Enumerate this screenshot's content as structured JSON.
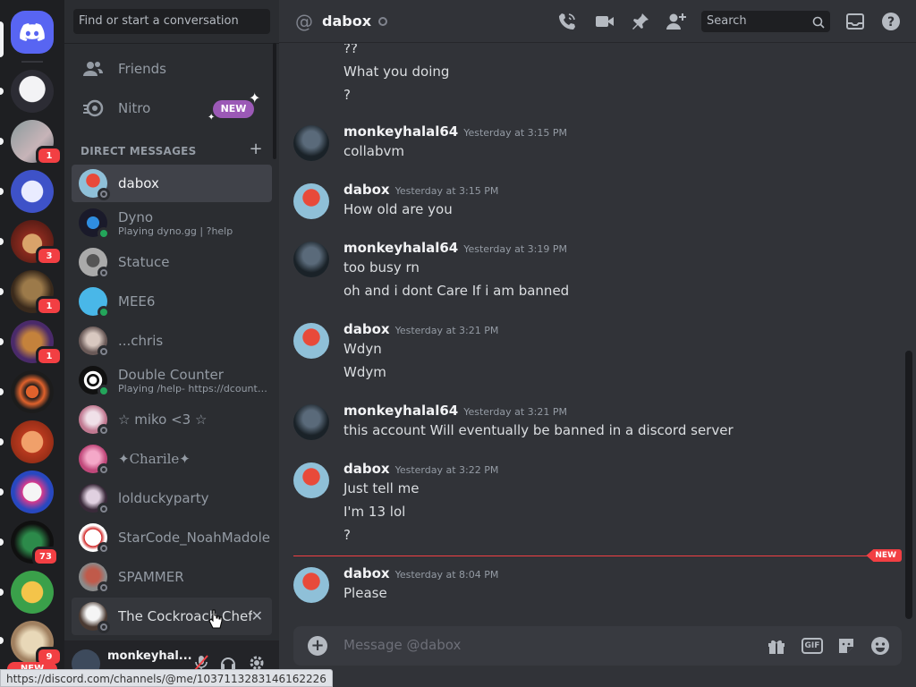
{
  "rail": {
    "badges": [
      "1",
      "3",
      "1",
      "1",
      "73",
      "9"
    ],
    "new_label": "NEW"
  },
  "sidebar": {
    "search_placeholder": "Find or start a conversation",
    "friends_label": "Friends",
    "nitro_label": "Nitro",
    "nitro_badge": "NEW",
    "dm_header": "DIRECT MESSAGES",
    "dms": [
      {
        "name": "dabox",
        "sub": ""
      },
      {
        "name": "Dyno",
        "sub": "Playing dyno.gg | ?help"
      },
      {
        "name": "Statuce",
        "sub": ""
      },
      {
        "name": "MEE6",
        "sub": ""
      },
      {
        "name": "...chris",
        "sub": ""
      },
      {
        "name": "Double Counter",
        "sub": "Playing /help- https://dcounte..."
      },
      {
        "name": "☆ miko <3 ☆",
        "sub": ""
      },
      {
        "name": "✦Charile✦",
        "sub": ""
      },
      {
        "name": "lolduckyparty",
        "sub": ""
      },
      {
        "name": "StarCode_NoahMadole",
        "sub": ""
      },
      {
        "name": "SPAMMER",
        "sub": ""
      },
      {
        "name": "The Cockroach Chef",
        "sub": ""
      }
    ]
  },
  "user_panel": {
    "name": "monkeyhal..."
  },
  "url_bar": "https://discord.com/channels/@me/1037113283146162226",
  "header": {
    "channel": "dabox",
    "search_placeholder": "Search"
  },
  "messages": [
    {
      "lines": [
        "??",
        "What you doing",
        "?"
      ]
    },
    {
      "author": "monkeyhalal64",
      "time": "Yesterday at 3:15 PM",
      "lines": [
        "collabvm"
      ]
    },
    {
      "author": "dabox",
      "time": "Yesterday at 3:15 PM",
      "lines": [
        "How old are you"
      ]
    },
    {
      "author": "monkeyhalal64",
      "time": "Yesterday at 3:19 PM",
      "lines": [
        "too busy rn",
        "oh and i dont Care If i am banned"
      ]
    },
    {
      "author": "dabox",
      "time": "Yesterday at 3:21 PM",
      "lines": [
        "Wdyn",
        "Wdym"
      ]
    },
    {
      "author": "monkeyhalal64",
      "time": "Yesterday at 3:21 PM",
      "lines": [
        "this account Will eventually be banned in a discord server"
      ]
    },
    {
      "author": "dabox",
      "time": "Yesterday at 3:22 PM",
      "lines": [
        "Just tell me",
        "I'm 13 lol",
        "?"
      ]
    },
    {
      "author": "dabox",
      "time": "Yesterday at 8:04 PM",
      "lines": [
        "Please"
      ]
    }
  ],
  "new_divider": "NEW",
  "composer": {
    "placeholder": "Message @dabox",
    "gif_label": "GIF"
  },
  "colors": {
    "accent": "#5865f2",
    "danger": "#f23f43",
    "online": "#23a55a",
    "nitro": "#9b59b6"
  },
  "icons": [
    "discord-logo-icon",
    "phone-icon",
    "video-icon",
    "pin-icon",
    "add-friend-icon",
    "search-icon",
    "inbox-icon",
    "help-icon",
    "friends-icon",
    "nitro-icon",
    "plus-icon",
    "close-icon",
    "mic-muted-icon",
    "headphones-icon",
    "gear-icon",
    "gift-icon",
    "gif-icon",
    "sticker-icon",
    "emoji-icon"
  ]
}
